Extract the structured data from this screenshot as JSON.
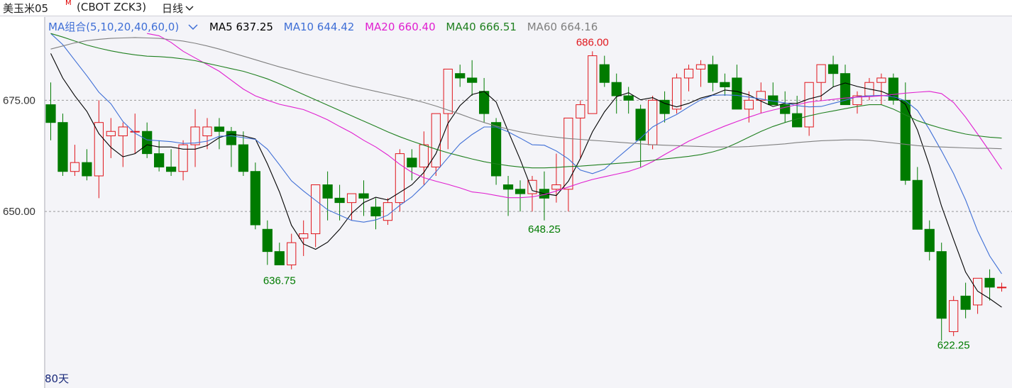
{
  "header": {
    "symbol": "美玉米05",
    "symbol_sup": "M",
    "code": "(CBOT ZCK3)",
    "period": "日线",
    "period_icon": "chevron-down-icon"
  },
  "legend": {
    "group_label": "MA组合(5,10,20,40,60,0)",
    "group_icon": "chevron-down-icon",
    "items": [
      {
        "label": "MA5 637.25",
        "color": "#000000"
      },
      {
        "label": "MA10 644.42",
        "color": "#3f6fd6"
      },
      {
        "label": "MA20 660.40",
        "color": "#e020d0"
      },
      {
        "label": "MA40 666.51",
        "color": "#208020"
      },
      {
        "label": "MA60 664.16",
        "color": "#808080"
      }
    ]
  },
  "footer": {
    "days_label": "80天"
  },
  "colors": {
    "up": "#e0161c",
    "down": "#007b00",
    "grid": "#9a9a9a"
  },
  "chart_data": {
    "type": "candlestick",
    "y_ticks": [
      675,
      650
    ],
    "y_tick_labels": [
      "675.00",
      "650.00"
    ],
    "ylim": [
      610.5,
      693.7
    ],
    "annotations": [
      {
        "label": "686.00",
        "value": 686.0,
        "index": 45,
        "color": "#e0161c"
      },
      {
        "label": "648.25",
        "value": 648.25,
        "index": 41,
        "color": "#007b00"
      },
      {
        "label": "636.75",
        "value": 636.75,
        "index": 19,
        "color": "#007b00"
      },
      {
        "label": "622.25",
        "value": 622.25,
        "index": 75,
        "color": "#007b00"
      }
    ],
    "candles": [
      [
        674,
        679,
        666,
        670
      ],
      [
        670,
        672,
        658,
        659
      ],
      [
        659,
        665,
        658,
        661
      ],
      [
        661,
        664,
        657,
        658
      ],
      [
        658,
        675,
        653,
        670
      ],
      [
        667,
        671,
        662,
        668
      ],
      [
        667,
        670,
        660,
        669
      ],
      [
        668,
        672,
        663,
        668
      ],
      [
        668,
        670,
        662,
        663
      ],
      [
        663,
        666,
        659,
        660
      ],
      [
        660,
        664,
        658,
        659
      ],
      [
        659,
        666,
        657,
        665
      ],
      [
        665,
        673,
        660,
        669
      ],
      [
        667,
        671,
        664,
        669
      ],
      [
        669,
        671,
        664,
        668
      ],
      [
        668,
        669,
        660,
        665
      ],
      [
        665,
        668,
        658,
        659
      ],
      [
        659,
        661,
        646,
        647
      ],
      [
        646,
        648,
        638,
        641
      ],
      [
        641,
        643,
        638,
        638
      ],
      [
        638,
        645,
        637,
        643
      ],
      [
        644,
        648,
        640,
        645
      ],
      [
        645,
        652,
        642,
        656
      ],
      [
        656,
        659,
        648,
        653
      ],
      [
        653,
        656,
        648,
        652
      ],
      [
        652,
        654,
        648,
        654
      ],
      [
        654,
        657,
        649,
        653
      ],
      [
        651,
        653,
        646,
        649
      ],
      [
        648,
        653,
        647,
        652
      ],
      [
        652,
        664,
        650,
        663
      ],
      [
        662,
        664,
        657,
        660
      ],
      [
        660,
        668,
        656,
        665
      ],
      [
        660,
        672,
        658,
        672
      ],
      [
        672,
        673,
        664,
        682
      ],
      [
        681,
        683,
        678,
        680
      ],
      [
        680,
        684,
        676,
        679
      ],
      [
        677,
        680,
        670,
        672
      ],
      [
        670,
        671,
        656,
        658
      ],
      [
        656,
        658,
        649,
        655
      ],
      [
        655,
        657,
        650,
        654
      ],
      [
        654,
        658,
        650,
        657
      ],
      [
        655,
        659,
        648,
        653
      ],
      [
        655,
        663,
        652,
        656
      ],
      [
        655,
        671,
        650,
        671
      ],
      [
        671,
        675,
        662,
        674
      ],
      [
        672,
        686,
        672,
        685
      ],
      [
        683,
        685,
        678,
        679
      ],
      [
        679,
        681,
        672,
        676
      ],
      [
        676,
        678,
        672,
        675
      ],
      [
        673,
        674,
        660,
        666
      ],
      [
        665,
        676,
        664,
        675
      ],
      [
        675,
        677,
        670,
        672
      ],
      [
        673,
        681,
        672,
        680
      ],
      [
        680,
        683,
        677,
        682
      ],
      [
        682,
        684,
        678,
        683
      ],
      [
        683,
        685,
        677,
        679
      ],
      [
        679,
        681,
        676,
        678
      ],
      [
        680,
        683,
        675,
        673
      ],
      [
        673,
        677,
        670,
        675
      ],
      [
        675,
        679,
        672,
        677
      ],
      [
        676,
        679,
        675,
        674
      ],
      [
        674,
        677,
        670,
        672
      ],
      [
        672,
        676,
        670,
        669
      ],
      [
        669,
        679,
        667,
        679
      ],
      [
        679,
        683,
        675,
        683
      ],
      [
        683,
        685,
        678,
        681
      ],
      [
        681,
        683,
        676,
        674
      ],
      [
        674,
        677,
        672,
        676
      ],
      [
        676,
        680,
        675,
        679
      ],
      [
        679,
        681,
        674,
        680
      ],
      [
        680,
        681,
        674,
        675
      ],
      [
        675,
        679,
        656,
        657
      ],
      [
        657,
        660,
        648,
        646
      ],
      [
        646,
        648,
        639,
        641
      ],
      [
        641,
        643,
        621,
        626
      ],
      [
        623,
        631,
        622,
        630
      ],
      [
        631,
        634,
        626,
        628
      ],
      [
        629,
        635,
        627,
        635
      ],
      [
        635,
        637,
        630,
        633
      ],
      [
        633,
        634,
        632,
        633
      ]
    ],
    "ma_lines": [
      {
        "name": "MA5",
        "color": "#000000",
        "values": [
          685.5,
          680,
          676,
          672.5,
          667.5,
          664.4,
          662.3,
          663,
          665,
          664.5,
          664.5,
          664,
          664,
          664.8,
          666.6,
          667.4,
          667,
          666.3,
          660.7,
          654.4,
          646.9,
          642.7,
          641.5,
          643.1,
          646,
          649.6,
          652,
          653.2,
          652.6,
          654.3,
          656,
          658.8,
          663,
          669.8,
          673.8,
          676.3,
          677,
          674.6,
          668,
          661.7,
          654.7,
          654,
          653.6,
          656.8,
          661.9,
          667.9,
          672.4,
          675.8,
          676.7,
          675.1,
          675.6,
          674.3,
          673.5,
          674.3,
          675.5,
          676.2,
          677.3,
          677,
          676.2,
          674.8,
          673.6,
          674.3,
          674.3,
          675.3,
          676,
          678,
          678.9,
          678.1,
          677.5,
          677,
          675.9,
          674.1,
          668.3,
          660.3,
          651.2,
          643.7,
          636.4,
          632.1,
          630.4,
          628.5
        ]
      },
      {
        "name": "MA10",
        "color": "#3f6fd6",
        "values": [
          690,
          687.5,
          684,
          680.5,
          676.8,
          674.2,
          670.2,
          667.6,
          666.1,
          665.9,
          665.7,
          665.3,
          665.4,
          665.8,
          666.9,
          667,
          666.6,
          666.2,
          664,
          660.5,
          656.9,
          654.6,
          652.5,
          650.4,
          649.2,
          648,
          647.6,
          648.1,
          649.2,
          651.4,
          653.3,
          655.9,
          658.9,
          662.1,
          665.2,
          667.3,
          669,
          669,
          667.9,
          666.5,
          665,
          664.9,
          663.6,
          661.8,
          659.3,
          658.5,
          659.5,
          661.9,
          664.2,
          666.5,
          669,
          670.5,
          671.8,
          673.5,
          675.1,
          676.1,
          676.2,
          676.1,
          675.7,
          675.3,
          674.8,
          674.4,
          673.8,
          673.5,
          673.6,
          674.3,
          675,
          675.8,
          676,
          676.1,
          675.8,
          674.9,
          672.7,
          668.4,
          663.6,
          658.5,
          652.6,
          645.6,
          640,
          636
        ]
      },
      {
        "name": "MA20",
        "color": "#e020d0",
        "values": [
          690,
          689.5,
          688,
          686,
          684.5,
          683,
          681.5,
          679.5,
          677.5,
          676,
          675,
          674.1,
          673.5,
          672.9,
          671.8,
          670.6,
          669.1,
          667.7,
          666,
          664.5,
          662.7,
          660.6,
          658.8,
          657.6,
          656.8,
          656.1,
          655.3,
          654.4,
          654.1,
          653.6,
          653.1,
          653.1,
          653.3,
          653.8,
          654.6,
          655.5,
          656.4,
          657.2,
          657.8,
          658.4,
          659,
          659.9,
          661.2,
          662.8,
          664.3,
          665.8,
          667,
          668.1,
          669.2,
          670.2,
          671.2,
          672.1,
          672.8,
          673.4,
          674,
          674.6,
          674.9,
          675.2,
          675.5,
          675.7,
          675.8,
          676,
          676.3,
          676.6,
          676.8,
          677,
          676.5,
          674.5,
          671.2,
          667.4,
          663.5,
          659.5
        ]
      },
      {
        "name": "MA40",
        "color": "#208020",
        "values": [
          690,
          689.2,
          688.3,
          687.4,
          686.7,
          686.1,
          685.6,
          685.2,
          684.9,
          684.8,
          684.6,
          684.3,
          683.9,
          683.3,
          682.7,
          682.1,
          681.5,
          680.7,
          679.8,
          678.7,
          677.5,
          676.3,
          675.1,
          673.9,
          672.7,
          671.5,
          670.3,
          669.1,
          667.9,
          666.8,
          665.8,
          664.9,
          664,
          663.2,
          662.5,
          661.8,
          661.2,
          660.7,
          660.3,
          660,
          659.8,
          659.8,
          659.9,
          660.1,
          660.2,
          660.4,
          660.6,
          660.8,
          661,
          661.3,
          661.5,
          661.8,
          662.1,
          662.4,
          662.8,
          663.4,
          664.2,
          665.4,
          666.7,
          668,
          669.1,
          670,
          670.8,
          671.5,
          672.1,
          672.6,
          673.1,
          673.6,
          674,
          674,
          673,
          671.7,
          670.4,
          669.5,
          668.7,
          668,
          667.4,
          667,
          666.7,
          666.5
        ]
      },
      {
        "name": "MA60",
        "color": "#808080",
        "values": [
          686.5,
          687.2,
          687.9,
          688.4,
          688.7,
          688.9,
          689,
          689.1,
          689,
          688.9,
          688.6,
          688.3,
          687.8,
          687.2,
          686.5,
          685.7,
          684.9,
          684.1,
          683.3,
          682.5,
          681.8,
          681,
          680.3,
          679.6,
          678.9,
          678.2,
          677.6,
          677,
          676.4,
          675.8,
          675.2,
          674.5,
          673.7,
          672.8,
          671.9,
          670.9,
          670,
          669.2,
          668.5,
          667.9,
          667.4,
          667,
          666.7,
          666.4,
          666.2,
          666,
          665.8,
          665.6,
          665.4,
          665.2,
          665,
          664.9,
          664.8,
          664.7,
          664.6,
          664.5,
          664.5,
          664.5,
          664.6,
          664.8,
          665,
          665.2,
          665.5,
          665.7,
          665.9,
          666,
          666.1,
          666.1,
          666,
          665.7,
          665.4,
          665.1,
          664.8,
          664.6,
          664.5,
          664.4,
          664.3,
          664.2,
          664.2,
          664.1
        ]
      }
    ]
  }
}
